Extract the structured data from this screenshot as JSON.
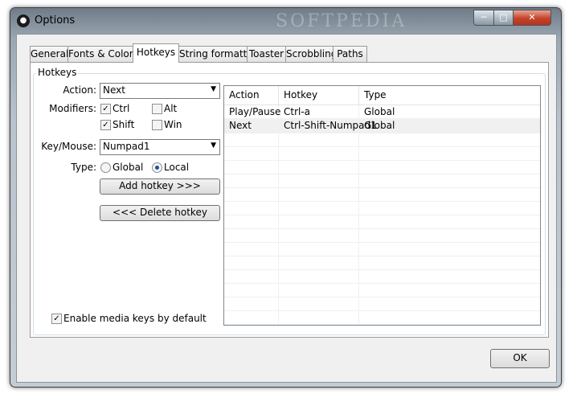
{
  "window": {
    "title": "Options",
    "watermark": "SOFTPEDIA"
  },
  "tabs": [
    "General",
    "Fonts & Colors",
    "Hotkeys",
    "String formatting",
    "Toaster",
    "Scrobbling",
    "Paths"
  ],
  "hotkeys": {
    "group_label": "Hotkeys",
    "action_label": "Action:",
    "action_value": "Next",
    "modifiers_label": "Modifiers:",
    "modifiers": {
      "ctrl": "Ctrl",
      "alt": "Alt",
      "shift": "Shift",
      "win": "Win"
    },
    "keymouse_label": "Key/Mouse:",
    "keymouse_value": "Numpad1",
    "type_label": "Type:",
    "type_global": "Global",
    "type_local": "Local",
    "add_button": "Add hotkey >>>",
    "delete_button": "<<< Delete hotkey",
    "media_keys_label": "Enable media keys by default",
    "table": {
      "headers": [
        "Action",
        "Hotkey",
        "Type"
      ],
      "rows": [
        [
          "Play/Pause",
          "Ctrl-a",
          "Global"
        ],
        [
          "Next",
          "Ctrl-Shift-Numpad1",
          "Global"
        ]
      ]
    }
  },
  "ok_button": "OK"
}
